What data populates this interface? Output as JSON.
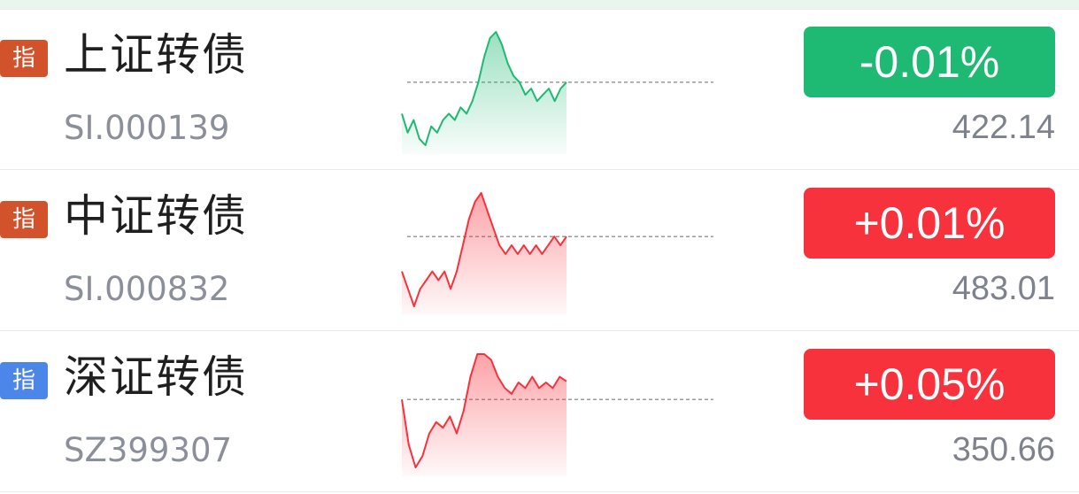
{
  "colors": {
    "up": "#f8323c",
    "down": "#1eb972",
    "tag_sh": "#d2532b",
    "tag_sz": "#4b86e8",
    "baseline": "#999999"
  },
  "rows": [
    {
      "tag": "指",
      "tag_color": "#d2532b",
      "name": "上证转债",
      "code": "SI.000139",
      "change": "-0.01%",
      "change_direction": "down",
      "price": "422.14",
      "sparkline": {
        "trend": "down",
        "values": [
          422.1,
          421.8,
          422.0,
          421.7,
          421.6,
          421.9,
          421.8,
          422.0,
          422.1,
          422.0,
          422.2,
          422.1,
          422.3,
          422.6,
          423.0,
          423.3,
          423.4,
          423.2,
          422.9,
          422.7,
          422.6,
          422.4,
          422.5,
          422.3,
          422.4,
          422.5,
          422.3,
          422.5,
          422.6
        ],
        "baseline": 422.6
      }
    },
    {
      "tag": "指",
      "tag_color": "#d2532b",
      "name": "中证转债",
      "code": "SI.000832",
      "change": "+0.01%",
      "change_direction": "up",
      "price": "483.01",
      "sparkline": {
        "trend": "up",
        "values": [
          482.6,
          482.4,
          482.2,
          482.4,
          482.5,
          482.6,
          482.5,
          482.6,
          482.4,
          482.6,
          482.9,
          483.2,
          483.4,
          483.5,
          483.3,
          483.1,
          482.9,
          482.8,
          482.9,
          482.8,
          482.9,
          482.8,
          482.9,
          482.8,
          482.9,
          483.0,
          482.9,
          483.0
        ],
        "baseline": 483.0
      }
    },
    {
      "tag": "指",
      "tag_color": "#4b86e8",
      "name": "深证转债",
      "code": "SZ399307",
      "change": "+0.05%",
      "change_direction": "up",
      "price": "350.66",
      "sparkline": {
        "trend": "up",
        "values": [
          350.5,
          350.1,
          349.9,
          350.0,
          350.2,
          350.3,
          350.25,
          350.35,
          350.2,
          350.4,
          350.7,
          350.9,
          350.9,
          350.85,
          350.7,
          350.6,
          350.55,
          350.65,
          350.6,
          350.7,
          350.6,
          350.65,
          350.6,
          350.7,
          350.66
        ],
        "baseline": 350.5
      }
    }
  ]
}
